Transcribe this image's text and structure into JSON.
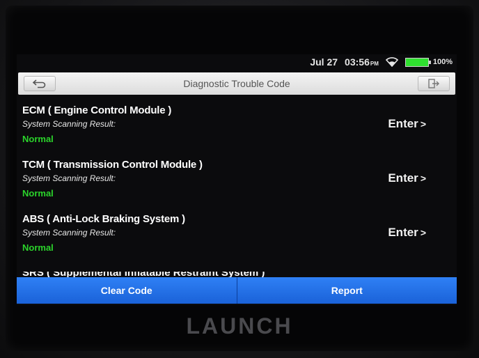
{
  "status_bar": {
    "date": "Jul 27",
    "time": "03:56",
    "ampm": "PM",
    "battery": "100%"
  },
  "header": {
    "title": "Diagnostic Trouble Code",
    "back_icon": "back-arrow-icon",
    "exit_icon": "exit-icon"
  },
  "systems": [
    {
      "name": "ECM ( Engine Control Module )",
      "result_label": "System Scanning Result:",
      "status": "Normal",
      "action": "Enter"
    },
    {
      "name": "TCM ( Transmission Control Module )",
      "result_label": "System Scanning Result:",
      "status": "Normal",
      "action": "Enter"
    },
    {
      "name": "ABS ( Anti-Lock Braking System )",
      "result_label": "System Scanning Result:",
      "status": "Normal",
      "action": "Enter"
    },
    {
      "name": "SRS ( Supplemental Inflatable Restraint System )"
    }
  ],
  "actions": {
    "clear_code": "Clear Code",
    "report": "Report"
  },
  "brand": {
    "logo_text": "LAUNCH"
  },
  "colors": {
    "status_normal": "#2bd42b",
    "action_bar": "#1f6fe8",
    "battery": "#2fe02f"
  }
}
